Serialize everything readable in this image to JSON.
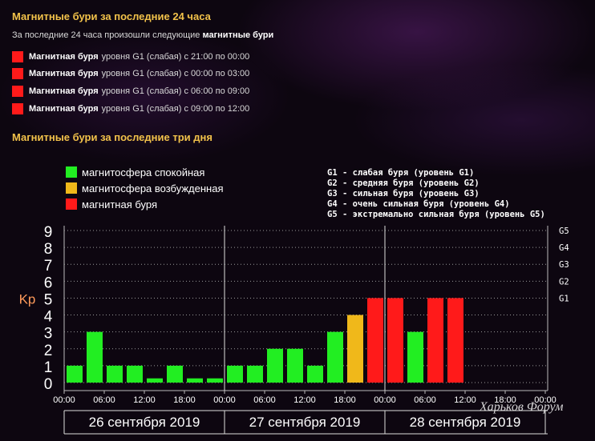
{
  "header": {
    "title": "Магнитные бури за последние 24 часа",
    "intro_text": "За последние 24 часа произошли следующие",
    "intro_bold": "магнитные бури",
    "storms": [
      {
        "name": "Магнитная буря",
        "text": "уровня G1 (слабая) с 21:00 по 00:00"
      },
      {
        "name": "Магнитная буря",
        "text": "уровня G1 (слабая) с 00:00 по 03:00"
      },
      {
        "name": "Магнитная буря",
        "text": "уровня G1 (слабая) с 06:00 по 09:00"
      },
      {
        "name": "Магнитная буря",
        "text": "уровня G1 (слабая) с 09:00 по 12:00"
      }
    ],
    "section_title": "Магнитные бури за последние три дня",
    "storm_color": "#ff1a1a"
  },
  "chart_data": {
    "type": "bar",
    "ylabel": "Kp",
    "ylim": [
      0,
      9
    ],
    "yticks": [
      "0",
      "1",
      "2",
      "3",
      "4",
      "5",
      "6",
      "7",
      "8",
      "9"
    ],
    "g_levels": [
      {
        "label": "G1",
        "kp": 5
      },
      {
        "label": "G2",
        "kp": 6
      },
      {
        "label": "G3",
        "kp": 7
      },
      {
        "label": "G4",
        "kp": 8
      },
      {
        "label": "G5",
        "kp": 9
      }
    ],
    "legend": [
      {
        "label": "магнитосфера спокойная",
        "color": "#22ee22"
      },
      {
        "label": "магнитосфера возбужденная",
        "color": "#f0b81a"
      },
      {
        "label": "магнитная буря",
        "color": "#ff1a1a"
      }
    ],
    "g_legend": [
      "G1 - слабая буря (уровень G1)",
      "G2 - средняя буря (уровень G2)",
      "G3 - сильная буря (уровень G3)",
      "G4 - очень сильная буря (уровень G4)",
      "G5 - экстремально сильная буря (уровень G5)"
    ],
    "time_labels": [
      "00:00",
      "06:00",
      "12:00",
      "18:00",
      "00:00",
      "06:00",
      "12:00",
      "18:00",
      "00:00",
      "06:00",
      "12:00",
      "18:00",
      "00:00"
    ],
    "days": [
      "26 сентября 2019",
      "27 сентября 2019",
      "28 сентября 2019"
    ],
    "values": [
      1,
      3,
      1,
      1,
      0.25,
      1,
      0.25,
      0.25,
      1,
      1,
      2,
      2,
      1,
      3,
      4,
      5,
      5,
      3,
      5,
      5
    ],
    "status": [
      "calm",
      "calm",
      "calm",
      "calm",
      "calm",
      "calm",
      "calm",
      "calm",
      "calm",
      "calm",
      "calm",
      "calm",
      "calm",
      "calm",
      "active",
      "storm",
      "storm",
      "calm",
      "storm",
      "storm"
    ],
    "colors": {
      "calm": "#22ee22",
      "active": "#f0b81a",
      "storm": "#ff1a1a"
    },
    "grid": true
  },
  "watermark": "Харьков Форум"
}
